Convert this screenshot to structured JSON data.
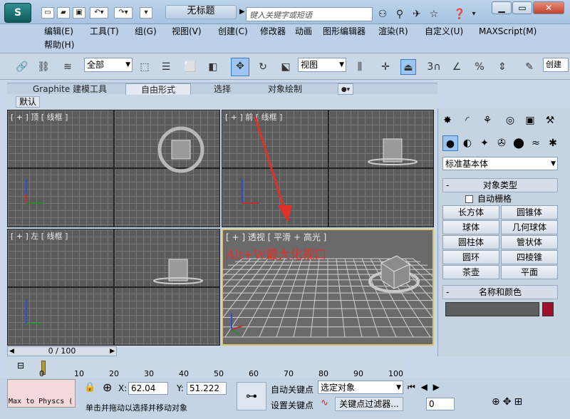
{
  "window": {
    "title": "无标题",
    "search_placeholder": "键入关键字或短语"
  },
  "menu": [
    "编辑(E)",
    "工具(T)",
    "组(G)",
    "视图(V)",
    "创建(C)",
    "修改器",
    "动画",
    "图形编辑器",
    "渲染(R)",
    "自定义(U)",
    "MAXScript(M)",
    "帮助(H)"
  ],
  "toolbar": {
    "selection_filter": "全部",
    "ref_coord": "视图",
    "create_sel": "创建"
  },
  "ribbon": {
    "tabs": [
      "Graphite 建模工具",
      "自由形式",
      "选择",
      "对象绘制"
    ],
    "sub": "默认"
  },
  "viewports": {
    "top": "[ + ] 顶 [ 线框 ]",
    "front": "[ + ] 前 [ 线框 ]",
    "left": "[ + ] 左 [ 线框 ]",
    "persp": "[ + ] 透视 [ 平滑 + 高光 ]",
    "annotation": "Alt+W最大化视口"
  },
  "command_panel": {
    "dropdown": "标准基本体",
    "object_type_title": "对象类型",
    "auto_grid": "自动栅格",
    "buttons": [
      "长方体",
      "圆锥体",
      "球体",
      "几何球体",
      "圆柱体",
      "管状体",
      "圆环",
      "四棱锥",
      "茶壶",
      "平面"
    ],
    "name_color_title": "名称和颜色"
  },
  "timeline": {
    "counter": "0 / 100",
    "ticks": [
      "0",
      "10",
      "20",
      "30",
      "40",
      "50",
      "60",
      "70",
      "80",
      "90",
      "100"
    ]
  },
  "status": {
    "script_listener": "Max to Physcs (",
    "x_label": "X:",
    "x_value": "62.04",
    "y_label": "Y:",
    "y_value": "51.222",
    "auto_key": "自动关键点",
    "set_key": "设置关键点",
    "key_select": "选定对象",
    "key_filter": "关键点过滤器...",
    "prompt": "单击并拖动以选择并移动对象",
    "frame": "0"
  },
  "colors": {
    "viewport_bg": "#5b5b5b",
    "active_border": "#d8c56a",
    "annotation": "#e0302a",
    "object_color": "#a0102a"
  }
}
